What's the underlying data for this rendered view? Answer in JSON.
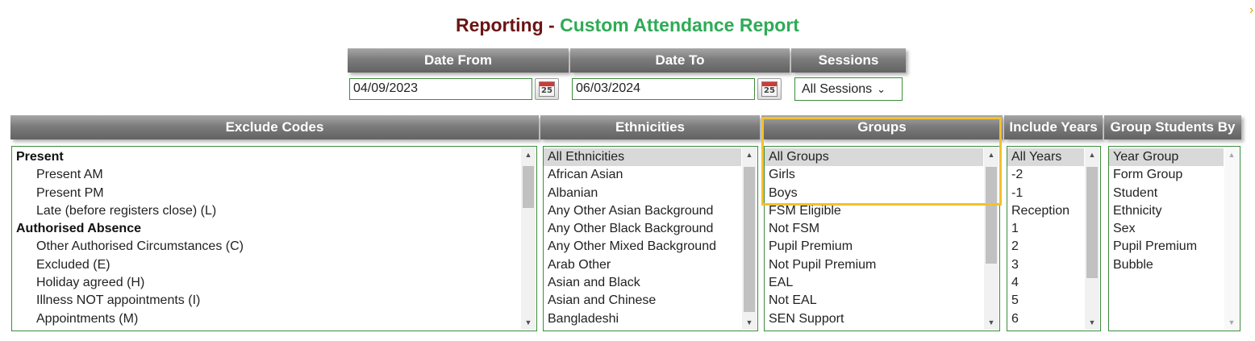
{
  "title": {
    "prefix": "Reporting - ",
    "main": "Custom Attendance Report"
  },
  "date_filters": {
    "date_from_label": "Date From",
    "date_from_value": "04/09/2023",
    "date_to_label": "Date To",
    "date_to_value": "06/03/2024",
    "sessions_label": "Sessions",
    "sessions_value": "All Sessions",
    "calendar_day": "25"
  },
  "exclude_codes": {
    "header": "Exclude Codes",
    "items": [
      {
        "label": "Present",
        "type": "group"
      },
      {
        "label": "Present AM",
        "type": "sub"
      },
      {
        "label": "Present PM",
        "type": "sub"
      },
      {
        "label": "Late (before registers close) (L)",
        "type": "sub"
      },
      {
        "label": "Authorised Absence",
        "type": "group"
      },
      {
        "label": "Other Authorised Circumstances (C)",
        "type": "sub"
      },
      {
        "label": "Excluded (E)",
        "type": "sub"
      },
      {
        "label": "Holiday agreed (H)",
        "type": "sub"
      },
      {
        "label": "Illness NOT appointments (I)",
        "type": "sub"
      },
      {
        "label": "Appointments (M)",
        "type": "sub"
      }
    ]
  },
  "ethnicities": {
    "header": "Ethnicities",
    "items": [
      "All Ethnicities",
      "African Asian",
      "Albanian",
      "Any Other Asian Background",
      "Any Other Black Background",
      "Any Other Mixed Background",
      "Arab Other",
      "Asian and Black",
      "Asian and Chinese",
      "Bangladeshi"
    ]
  },
  "groups": {
    "header": "Groups",
    "items": [
      "All Groups",
      "Girls",
      "Boys",
      "FSM Eligible",
      "Not FSM",
      "Pupil Premium",
      "Not Pupil Premium",
      "EAL",
      "Not EAL",
      "SEN Support"
    ]
  },
  "include_years": {
    "header": "Include Years",
    "items": [
      "All Years",
      "-2",
      "-1",
      "Reception",
      "1",
      "2",
      "3",
      "4",
      "5",
      "6"
    ]
  },
  "group_students_by": {
    "header": "Group Students By",
    "items": [
      "Year Group",
      "Form Group",
      "Student",
      "Ethnicity",
      "Sex",
      "Pupil Premium",
      "Bubble"
    ]
  },
  "colors": {
    "title_prefix": "#6b1414",
    "title_main": "#2eab55",
    "border_green": "#3c8c3c",
    "highlight": "#f2c12e"
  }
}
